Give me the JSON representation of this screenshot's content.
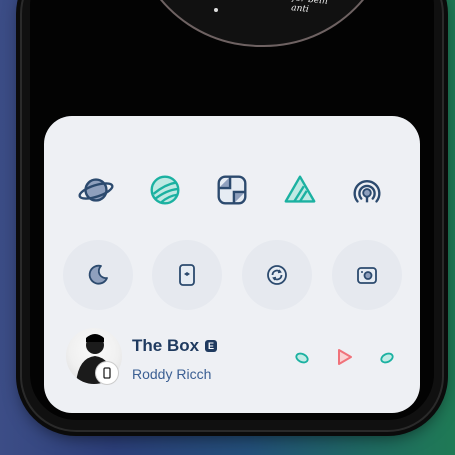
{
  "background_colors": [
    "#3c4d86",
    "#23507a",
    "#1f7a55"
  ],
  "now_playing": {
    "handwritten_note": "Please\n excuse me\n for bein\n anti"
  },
  "apps_row1": [
    {
      "icon": "planet-icon"
    },
    {
      "icon": "striped-globe-icon"
    },
    {
      "icon": "tile-app-icon"
    },
    {
      "icon": "triangle-stack-icon"
    },
    {
      "icon": "broadcast-icon"
    }
  ],
  "toggles": [
    {
      "icon": "moon-icon"
    },
    {
      "icon": "phone-screen-icon"
    },
    {
      "icon": "rotate-icon"
    },
    {
      "icon": "camera-icon"
    }
  ],
  "media": {
    "title": "The Box",
    "explicit_badge": "E",
    "artist": "Roddy Ricch",
    "controls": [
      "previous-icon",
      "play-icon",
      "next-icon"
    ]
  },
  "colors": {
    "panel": "#eef0f4",
    "title": "#1f3a5f",
    "artist": "#3b5f93",
    "teal": "#1bb1a1",
    "navy": "#2c4a6e",
    "play_red": "#f0727a"
  }
}
